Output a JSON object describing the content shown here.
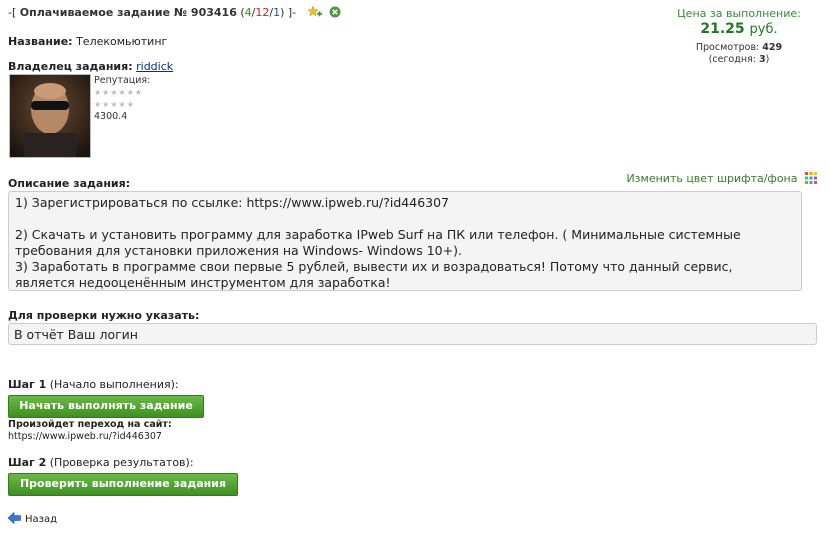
{
  "header": {
    "prefix": "-[",
    "title": "Оплачиваемое задание № 903416",
    "counts_open": " (",
    "count_a": "4",
    "count_b": "12",
    "count_c": "1",
    "counts_close": ")",
    "suffix": "]-"
  },
  "price": {
    "label": "Цена за выполнение:",
    "value": "21.25",
    "unit": "руб.",
    "views_label": "Просмотров:",
    "views": "429",
    "today_label": "(сегодня:",
    "today": "3",
    "today_close": ")"
  },
  "task": {
    "name_label": "Название:",
    "name": "Телекомьютинг",
    "owner_label": "Владелец задания:",
    "owner": "riddick",
    "reputation_label": "Репутация:",
    "rating": "4300.4"
  },
  "description": {
    "label": "Описание задания:",
    "change_color": "Изменить цвет шрифта/фона",
    "line1": "1) Зарегистрироваться по ссылке: https://www.ipweb.ru/?id446307",
    "line2": "2) Скачать и установить программу для заработка IPweb Surf на ПК или телефон. ( Минимальные системные требования для установки приложения на Windows- Windows 10+).",
    "line3": "3) Заработать в программе свои первые 5 рублей, вывести их и возрадоваться! Потому что данный сервис, является недооценённым инструментом для заработка!"
  },
  "check": {
    "label": "Для проверки нужно указать:",
    "value": "В отчёт Ваш логин"
  },
  "steps": {
    "step1_label": "Шаг 1",
    "step1_note": "(Начало выполнения):",
    "start_button": "Начать выполнять задание",
    "redirect_label": "Произойдет переход на сайт:",
    "redirect_url": "https://www.ipweb.ru/?id446307",
    "step2_label": "Шаг 2",
    "step2_note": "(Проверка результатов):",
    "check_button": "Проверить выполнение задания"
  },
  "nav": {
    "back": "Назад"
  },
  "colors": {
    "price_green": "#1f7a1f",
    "button_green": "#4a9a2a",
    "link_blue": "#0b2b8a"
  }
}
